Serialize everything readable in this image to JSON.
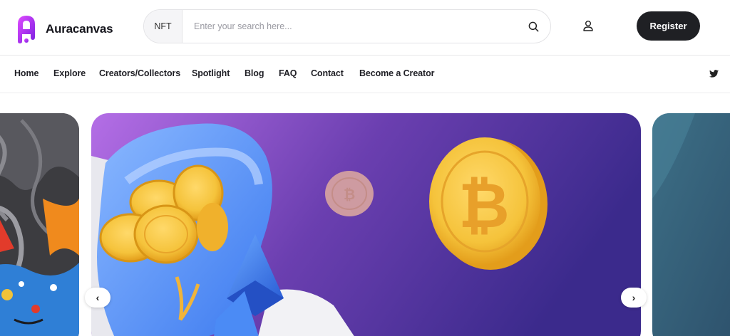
{
  "brand": {
    "name": "Auracanvas",
    "accent": "#a020f0"
  },
  "search": {
    "prefix": "NFT",
    "placeholder": "Enter your search here...",
    "icon": "search-icon"
  },
  "header": {
    "register_label": "Register",
    "user_icon": "user-icon"
  },
  "nav": {
    "items": [
      "Home",
      "Explore",
      "Creators/Collectors",
      "Spotlight",
      "Blog",
      "FAQ",
      "Contact",
      "Become a Creator"
    ],
    "social_icon": "twitter-icon"
  },
  "carousel": {
    "prev_label": "‹",
    "next_label": "›",
    "colors": {
      "gradient_start": "#b46ee6",
      "gradient_end": "#3b2a8c",
      "coin": "#f5c33b"
    }
  }
}
